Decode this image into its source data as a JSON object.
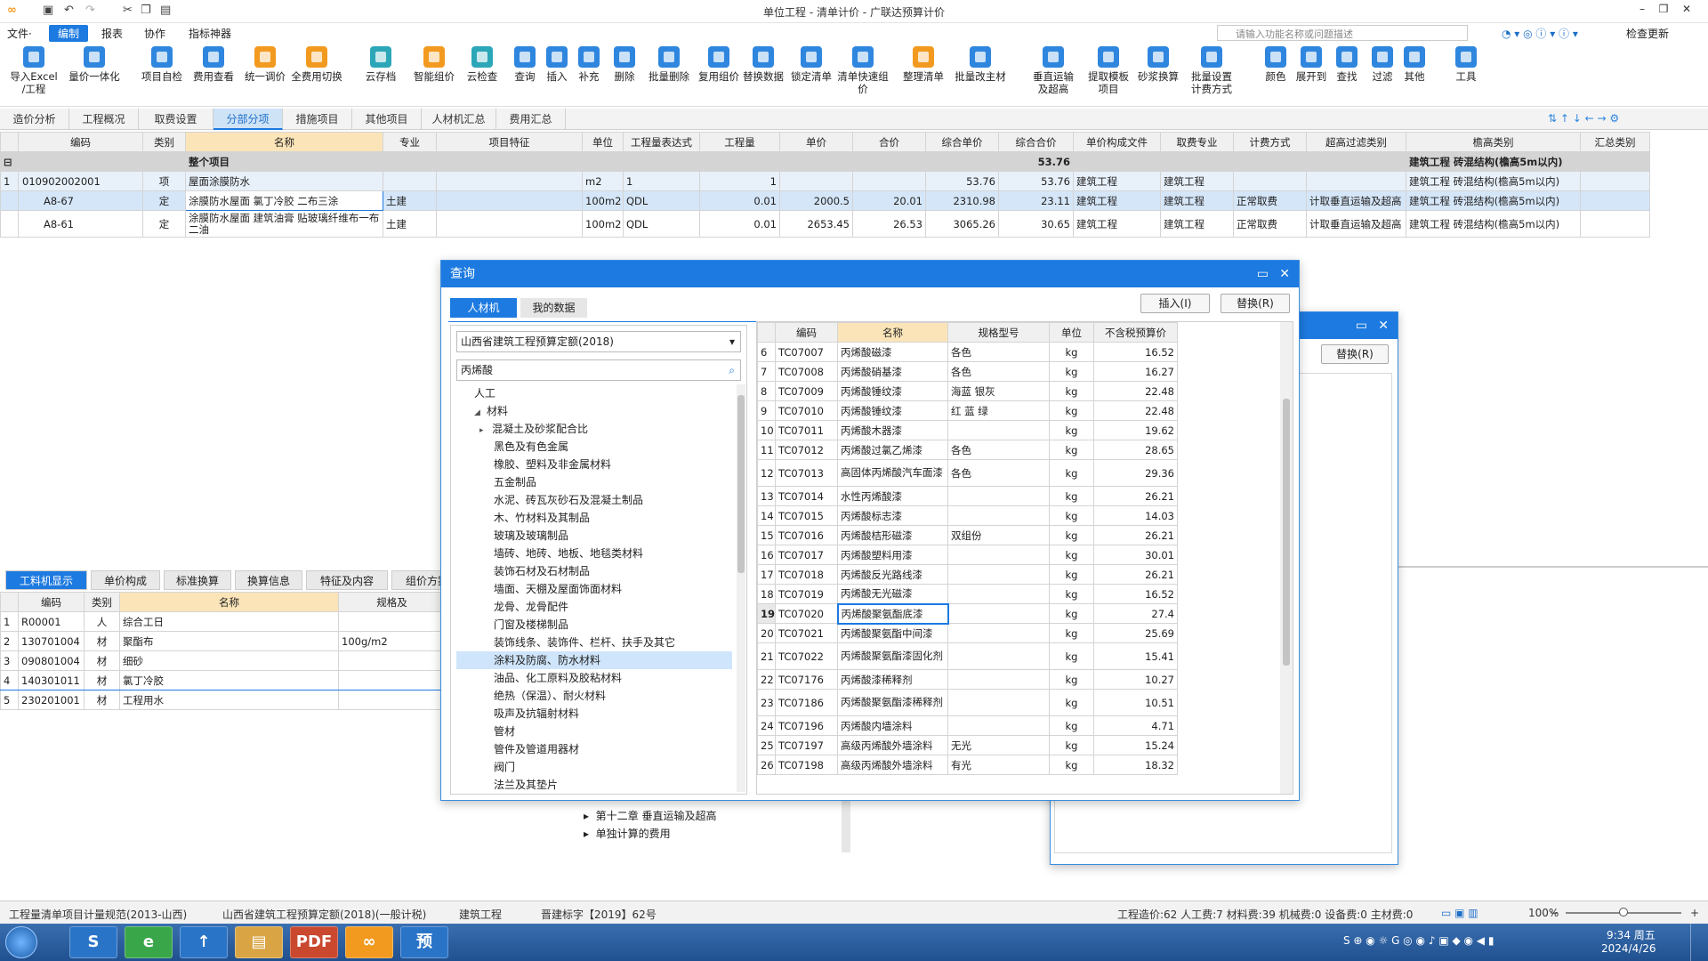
{
  "window": {
    "title": "单位工程 - 清单计价 - 广联达预算计价"
  },
  "menubar": {
    "items": [
      "文件·",
      "编制",
      "报表",
      "协作",
      "指标神器"
    ],
    "search_placeholder": "请输入功能名称或问题描述",
    "check_update": "检查更新"
  },
  "ribbon": [
    {
      "l1": "导入Excel",
      "l2": "/工程",
      "color": "blue"
    },
    {
      "l1": "量价一体化",
      "l2": "",
      "color": "blue"
    },
    {
      "l1": "项目自检",
      "l2": "",
      "color": "blue"
    },
    {
      "l1": "费用查看",
      "l2": "",
      "color": "blue"
    },
    {
      "l1": "统一调价",
      "l2": "",
      "color": "orange"
    },
    {
      "l1": "全费用切换",
      "l2": "",
      "color": "orange"
    },
    {
      "l1": "云存档",
      "l2": "",
      "color": "teal"
    },
    {
      "l1": "智能组价",
      "l2": "",
      "color": "orange"
    },
    {
      "l1": "云检查",
      "l2": "",
      "color": "teal"
    },
    {
      "l1": "查询",
      "l2": "",
      "color": "blue"
    },
    {
      "l1": "插入",
      "l2": "",
      "color": "blue"
    },
    {
      "l1": "补充",
      "l2": "",
      "color": "blue"
    },
    {
      "l1": "删除",
      "l2": "",
      "color": "blue"
    },
    {
      "l1": "批量删除",
      "l2": "",
      "color": "blue"
    },
    {
      "l1": "复用组价",
      "l2": "",
      "color": "blue"
    },
    {
      "l1": "替换数据",
      "l2": "",
      "color": "blue"
    },
    {
      "l1": "锁定清单",
      "l2": "",
      "color": "blue"
    },
    {
      "l1": "清单快速组价",
      "l2": "",
      "color": "blue"
    },
    {
      "l1": "整理清单",
      "l2": "",
      "color": "orange"
    },
    {
      "l1": "批量改主材",
      "l2": "",
      "color": "blue"
    },
    {
      "l1": "垂直运输",
      "l2": "及超高",
      "color": "blue"
    },
    {
      "l1": "提取模板",
      "l2": "项目",
      "color": "blue"
    },
    {
      "l1": "砂浆换算",
      "l2": "",
      "color": "blue"
    },
    {
      "l1": "批量设置",
      "l2": "计费方式",
      "color": "blue"
    },
    {
      "l1": "颜色",
      "l2": "",
      "color": "blue"
    },
    {
      "l1": "展开到",
      "l2": "",
      "color": "blue"
    },
    {
      "l1": "查找",
      "l2": "",
      "color": "blue"
    },
    {
      "l1": "过滤",
      "l2": "",
      "color": "blue"
    },
    {
      "l1": "其他",
      "l2": "",
      "color": "blue"
    },
    {
      "l1": "工具",
      "l2": "",
      "color": "blue"
    }
  ],
  "tabs": [
    "造价分析",
    "工程概况",
    "取费设置",
    "分部分项",
    "措施项目",
    "其他项目",
    "人材机汇总",
    "费用汇总"
  ],
  "main_table": {
    "headers": [
      "",
      "编码",
      "类别",
      "名称",
      "专业",
      "项目特征",
      "单位",
      "工程量表达式",
      "工程量",
      "单价",
      "合价",
      "综合单价",
      "综合合价",
      "单价构成文件",
      "取费专业",
      "计费方式",
      "超高过滤类别",
      "檐高类别",
      "汇总类别"
    ],
    "group_row": {
      "name": "整个项目",
      "total": "53.76",
      "eaves": "建筑工程 砖混结构(檐高5m以内)"
    },
    "rows": [
      {
        "no": "1",
        "code": "010902002001",
        "type": "项",
        "name": "屋面涂膜防水",
        "spec": "",
        "unit": "m2",
        "expr": "1",
        "qty": "1",
        "price": "",
        "amount": "",
        "cprice": "53.76",
        "camount": "53.76",
        "file": "建筑工程",
        "fee": "建筑工程",
        "mode": "",
        "over": "",
        "eaves": "建筑工程 砖混结构(檐高5m以内)"
      },
      {
        "no": "",
        "code": "A8-67",
        "type": "定",
        "name": "涂膜防水屋面 氯丁冷胶 二布三涂",
        "spec": "土建",
        "unit": "100m2",
        "expr": "QDL",
        "qty": "0.01",
        "price": "2000.5",
        "amount": "20.01",
        "cprice": "2310.98",
        "camount": "23.11",
        "file": "建筑工程",
        "fee": "建筑工程",
        "mode": "正常取费",
        "over": "计取垂直运输及超高",
        "eaves": "建筑工程 砖混结构(檐高5m以内)"
      },
      {
        "no": "",
        "code": "A8-61",
        "type": "定",
        "name": "涂膜防水屋面 建筑油膏 贴玻璃纤维布一布二油",
        "spec": "土建",
        "unit": "100m2",
        "expr": "QDL",
        "qty": "0.01",
        "price": "2653.45",
        "amount": "26.53",
        "cprice": "3065.26",
        "camount": "30.65",
        "file": "建筑工程",
        "fee": "建筑工程",
        "mode": "正常取费",
        "over": "计取垂直运输及超高",
        "eaves": "建筑工程 砖混结构(檐高5m以内)"
      }
    ]
  },
  "bottom": {
    "tabs": [
      "工料机显示",
      "单价构成",
      "标准换算",
      "换算信息",
      "特征及内容",
      "组价方案"
    ],
    "headers": [
      "",
      "编码",
      "类别",
      "名称",
      "规格及"
    ],
    "rows": [
      {
        "no": "1",
        "code": "R00001",
        "type": "人",
        "name": "综合工日",
        "spec": ""
      },
      {
        "no": "2",
        "code": "130701004",
        "type": "材",
        "name": "聚酯布",
        "spec": "100g/m2"
      },
      {
        "no": "3",
        "code": "090801004",
        "type": "材",
        "name": "细砂",
        "spec": ""
      },
      {
        "no": "4",
        "code": "140301011",
        "type": "材",
        "name": "氯丁冷胶",
        "spec": ""
      },
      {
        "no": "5",
        "code": "230201001",
        "type": "材",
        "name": "工程用水",
        "spec": ""
      }
    ]
  },
  "dialog": {
    "title": "查询",
    "tabs": [
      "人材机",
      "我的数据"
    ],
    "insert_btn": "插入(I)",
    "replace_btn": "替换(R)",
    "library": "山西省建筑工程预算定额(2018)",
    "search_value": "丙烯酸",
    "tree": [
      {
        "label": "人工",
        "level": 1,
        "arrow": ""
      },
      {
        "label": "材料",
        "level": 1,
        "arrow": "◢"
      },
      {
        "label": "混凝土及砂浆配合比",
        "level": 2,
        "arrow": "▸"
      },
      {
        "label": "黑色及有色金属",
        "level": 3,
        "arrow": ""
      },
      {
        "label": "橡胶、塑料及非金属材料",
        "level": 3,
        "arrow": ""
      },
      {
        "label": "五金制品",
        "level": 3,
        "arrow": ""
      },
      {
        "label": "水泥、砖瓦灰砂石及混凝土制品",
        "level": 3,
        "arrow": ""
      },
      {
        "label": "木、竹材料及其制品",
        "level": 3,
        "arrow": ""
      },
      {
        "label": "玻璃及玻璃制品",
        "level": 3,
        "arrow": ""
      },
      {
        "label": "墙砖、地砖、地板、地毯类材料",
        "level": 3,
        "arrow": ""
      },
      {
        "label": "装饰石材及石材制品",
        "level": 3,
        "arrow": ""
      },
      {
        "label": "墙面、天棚及屋面饰面材料",
        "level": 3,
        "arrow": ""
      },
      {
        "label": "龙骨、龙骨配件",
        "level": 3,
        "arrow": ""
      },
      {
        "label": "门窗及楼梯制品",
        "level": 3,
        "arrow": ""
      },
      {
        "label": "装饰线条、装饰件、栏杆、扶手及其它",
        "level": 3,
        "arrow": ""
      },
      {
        "label": "涂料及防腐、防水材料",
        "level": 3,
        "arrow": "",
        "selected": true
      },
      {
        "label": "油品、化工原料及胶粘材料",
        "level": 3,
        "arrow": ""
      },
      {
        "label": "绝热（保温）、耐火材料",
        "level": 3,
        "arrow": ""
      },
      {
        "label": "吸声及抗辐射材料",
        "level": 3,
        "arrow": ""
      },
      {
        "label": "管材",
        "level": 3,
        "arrow": ""
      },
      {
        "label": "管件及管道用器材",
        "level": 3,
        "arrow": ""
      },
      {
        "label": "阀门",
        "level": 3,
        "arrow": ""
      },
      {
        "label": "法兰及其垫片",
        "level": 3,
        "arrow": ""
      }
    ],
    "grid_headers": [
      "",
      "编码",
      "名称",
      "规格型号",
      "单位",
      "不含税预算价"
    ],
    "grid_rows": [
      {
        "no": "6",
        "code": "TC07007",
        "name": "丙烯酸磁漆",
        "spec": "各色",
        "unit": "kg",
        "price": "16.52"
      },
      {
        "no": "7",
        "code": "TC07008",
        "name": "丙烯酸硝基漆",
        "spec": "各色",
        "unit": "kg",
        "price": "16.27"
      },
      {
        "no": "8",
        "code": "TC07009",
        "name": "丙烯酸锤纹漆",
        "spec": "海蓝 银灰",
        "unit": "kg",
        "price": "22.48"
      },
      {
        "no": "9",
        "code": "TC07010",
        "name": "丙烯酸锤纹漆",
        "spec": "红 蓝 绿",
        "unit": "kg",
        "price": "22.48"
      },
      {
        "no": "10",
        "code": "TC07011",
        "name": "丙烯酸木器漆",
        "spec": "",
        "unit": "kg",
        "price": "19.62"
      },
      {
        "no": "11",
        "code": "TC07012",
        "name": "丙烯酸过氯乙烯漆",
        "spec": "各色",
        "unit": "kg",
        "price": "28.65"
      },
      {
        "no": "12",
        "code": "TC07013",
        "name": "高固体丙烯酸汽车面漆",
        "spec": "各色",
        "unit": "kg",
        "price": "29.36",
        "tall": true
      },
      {
        "no": "13",
        "code": "TC07014",
        "name": "水性丙烯酸漆",
        "spec": "",
        "unit": "kg",
        "price": "26.21"
      },
      {
        "no": "14",
        "code": "TC07015",
        "name": "丙烯酸标志漆",
        "spec": "",
        "unit": "kg",
        "price": "14.03"
      },
      {
        "no": "15",
        "code": "TC07016",
        "name": "丙烯酸桔形磁漆",
        "spec": "双组份",
        "unit": "kg",
        "price": "26.21"
      },
      {
        "no": "16",
        "code": "TC07017",
        "name": "丙烯酸塑料用漆",
        "spec": "",
        "unit": "kg",
        "price": "30.01"
      },
      {
        "no": "17",
        "code": "TC07018",
        "name": "丙烯酸反光路线漆",
        "spec": "",
        "unit": "kg",
        "price": "26.21"
      },
      {
        "no": "18",
        "code": "TC07019",
        "name": "丙烯酸无光磁漆",
        "spec": "",
        "unit": "kg",
        "price": "16.52"
      },
      {
        "no": "19",
        "code": "TC07020",
        "name": "丙烯酸聚氨酯底漆",
        "spec": "",
        "unit": "kg",
        "price": "27.4",
        "selected": true
      },
      {
        "no": "20",
        "code": "TC07021",
        "name": "丙烯酸聚氨酯中间漆",
        "spec": "",
        "unit": "kg",
        "price": "25.69"
      },
      {
        "no": "21",
        "code": "TC07022",
        "name": "丙烯酸聚氨酯漆固化剂",
        "spec": "",
        "unit": "kg",
        "price": "15.41",
        "tall": true
      },
      {
        "no": "22",
        "code": "TC07176",
        "name": "丙烯酸漆稀释剂",
        "spec": "",
        "unit": "kg",
        "price": "10.27"
      },
      {
        "no": "23",
        "code": "TC07186",
        "name": "丙烯酸聚氨酯漆稀释剂",
        "spec": "",
        "unit": "kg",
        "price": "10.51",
        "tall": true
      },
      {
        "no": "24",
        "code": "TC07196",
        "name": "丙烯酸内墙涂料",
        "spec": "",
        "unit": "kg",
        "price": "4.71"
      },
      {
        "no": "25",
        "code": "TC07197",
        "name": "高级丙烯酸外墙涂料",
        "spec": "无光",
        "unit": "kg",
        "price": "15.24"
      },
      {
        "no": "26",
        "code": "TC07198",
        "name": "高级丙烯酸外墙涂料",
        "spec": "有光",
        "unit": "kg",
        "price": "18.32"
      }
    ]
  },
  "dialog2": {
    "replace_btn": "替换(R)",
    "tree": [
      "第十二章 垂直运输及超高",
      "单独计算的费用"
    ]
  },
  "status": {
    "items": [
      "工程量清单项目计量规范(2013-山西)",
      "山西省建筑工程预算定额(2018)(一般计税)",
      "建筑工程",
      "晋建标字【2019】62号"
    ],
    "summary": "工程造价:62  人工费:7  材料费:39  机械费:0  设备费:0  主材费:0",
    "zoom": "100%"
  },
  "taskbar": {
    "apps": [
      "S",
      "e",
      "↑",
      "▤",
      "PDF",
      "∞",
      "预"
    ],
    "time": "9:34 周五",
    "date": "2024/4/26"
  }
}
